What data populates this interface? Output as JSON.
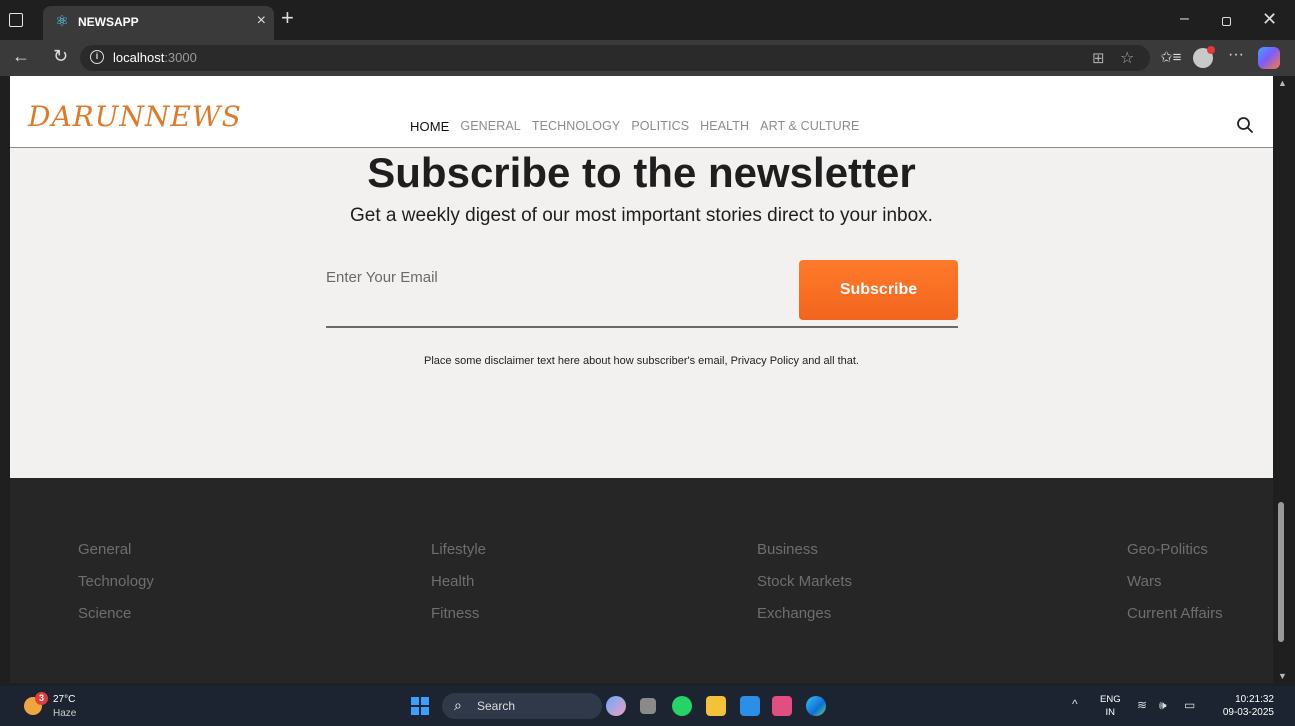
{
  "browser": {
    "tab_title": "NEWSAPP",
    "url_host": "localhost",
    "url_port": ":3000"
  },
  "site": {
    "logo": "DARUNNEWS",
    "nav": [
      "HOME",
      "GENERAL",
      "TECHNOLOGY",
      "POLITICS",
      "HEALTH",
      "ART & CULTURE"
    ],
    "active_nav": "HOME"
  },
  "newsletter": {
    "title": "Subscribe to the newsletter",
    "subtitle": "Get a weekly digest of our most important stories direct to your inbox.",
    "email_placeholder": "Enter Your Email",
    "subscribe_label": "Subscribe",
    "disclaimer": "Place some disclaimer text here about how subscriber's email, Privacy Policy and all that.",
    "accent_color": "#f56b1f"
  },
  "footer": {
    "columns": [
      [
        "General",
        "Technology",
        "Science"
      ],
      [
        "Lifestyle",
        "Health",
        "Fitness"
      ],
      [
        "Business",
        "Stock Markets",
        "Exchanges"
      ],
      [
        "Geo-Politics",
        "Wars",
        "Current Affairs"
      ]
    ]
  },
  "taskbar": {
    "weather_temp": "27°C",
    "weather_condition": "Haze",
    "weather_badge": "3",
    "search_label": "Search",
    "lang_top": "ENG",
    "lang_bottom": "IN",
    "time": "10:21:32",
    "date": "09-03-2025"
  }
}
